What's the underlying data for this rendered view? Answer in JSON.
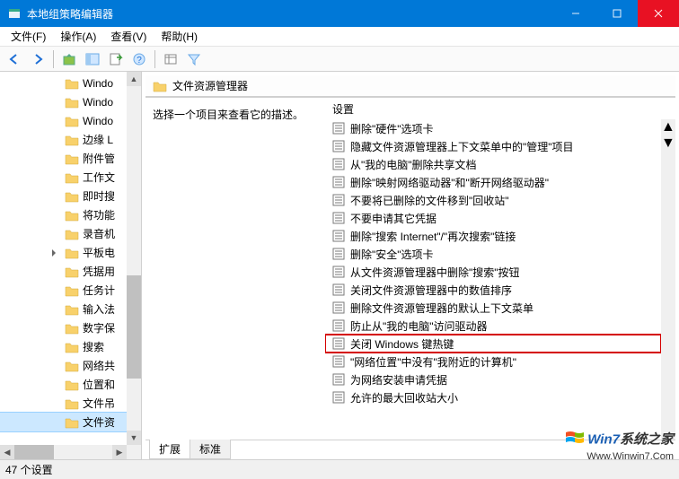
{
  "titlebar": {
    "title": "本地组策略编辑器"
  },
  "menu": {
    "file": "文件(F)",
    "action": "操作(A)",
    "view": "查看(V)",
    "help": "帮助(H)"
  },
  "tree": {
    "items": [
      {
        "label": "Windo",
        "expand": false
      },
      {
        "label": "Windo",
        "expand": false
      },
      {
        "label": "Windo",
        "expand": false
      },
      {
        "label": "边缘 L",
        "expand": false
      },
      {
        "label": "附件管",
        "expand": false
      },
      {
        "label": "工作文",
        "expand": false
      },
      {
        "label": "即时搜",
        "expand": false
      },
      {
        "label": "将功能",
        "expand": false
      },
      {
        "label": "录音机",
        "expand": false
      },
      {
        "label": "平板电",
        "expand": true
      },
      {
        "label": "凭据用",
        "expand": false
      },
      {
        "label": "任务计",
        "expand": false
      },
      {
        "label": "输入法",
        "expand": false
      },
      {
        "label": "数字保",
        "expand": false
      },
      {
        "label": "搜索",
        "expand": false
      },
      {
        "label": "网络共",
        "expand": false
      },
      {
        "label": "位置和",
        "expand": false
      },
      {
        "label": "文件吊",
        "expand": false
      },
      {
        "label": "文件资",
        "expand": false,
        "selected": true
      }
    ]
  },
  "right": {
    "header": "文件资源管理器",
    "desc": "选择一个项目来查看它的描述。",
    "column": "设置",
    "items": [
      {
        "label": "删除\"硬件\"选项卡"
      },
      {
        "label": "隐藏文件资源管理器上下文菜单中的\"管理\"项目"
      },
      {
        "label": "从\"我的电脑\"删除共享文档"
      },
      {
        "label": "删除\"映射网络驱动器\"和\"断开网络驱动器\""
      },
      {
        "label": "不要将已删除的文件移到\"回收站\""
      },
      {
        "label": "不要申请其它凭据"
      },
      {
        "label": "删除\"搜索 Internet\"/\"再次搜索\"链接"
      },
      {
        "label": "删除\"安全\"选项卡"
      },
      {
        "label": "从文件资源管理器中删除\"搜索\"按钮"
      },
      {
        "label": "关闭文件资源管理器中的数值排序"
      },
      {
        "label": "删除文件资源管理器的默认上下文菜单"
      },
      {
        "label": "防止从\"我的电脑\"访问驱动器"
      },
      {
        "label": "关闭 Windows 键热键",
        "highlight": true
      },
      {
        "label": "\"网络位置\"中没有\"我附近的计算机\""
      },
      {
        "label": "为网络安装申请凭据"
      },
      {
        "label": "允许的最大回收站大小"
      }
    ]
  },
  "tabs": {
    "extended": "扩展",
    "standard": "标准"
  },
  "status": "47 个设置",
  "watermark": {
    "line1_a": "Win7",
    "line1_b": "系统之家",
    "line2": "Www.Winwin7.Com"
  }
}
